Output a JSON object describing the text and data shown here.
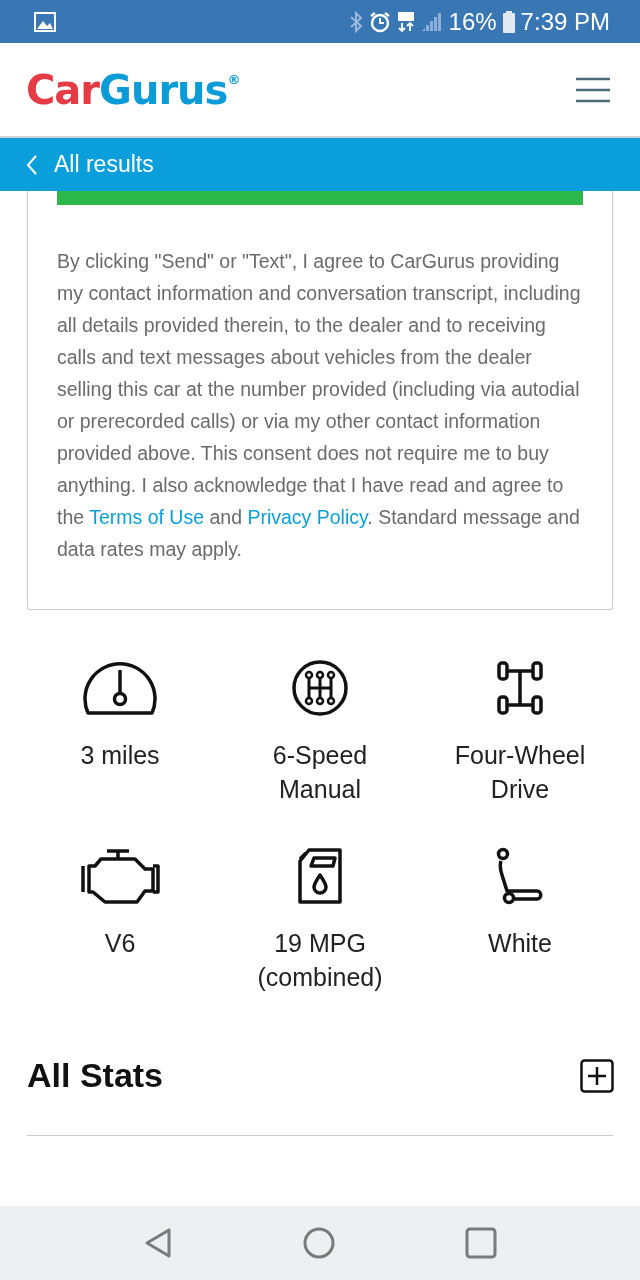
{
  "status_bar": {
    "battery": "16%",
    "time": "7:39 PM"
  },
  "header": {
    "logo": {
      "first": "Car",
      "second": "Gurus",
      "mark": "®"
    }
  },
  "nav_bar": {
    "back_label": "All results"
  },
  "consent": {
    "segments": [
      {
        "kind": "text",
        "text": "By clicking \"Send\" or \"Text\", I agree to CarGurus providing my contact information and conversation transcript, including all details provided therein, to the dealer and to receiving calls and text messages about vehicles from the dealer selling this car at the number provided (including via autodial or prerecorded calls) or via my other contact information provided above. This consent does not require me to buy anything. I also acknowledge that I have read and agree to the "
      },
      {
        "kind": "link",
        "text": "Terms of Use"
      },
      {
        "kind": "text",
        "text": " and "
      },
      {
        "kind": "link",
        "text": "Privacy Policy"
      },
      {
        "kind": "text",
        "text": ". Standard message and data rates may apply."
      }
    ]
  },
  "specs": [
    {
      "kind": "mileage",
      "label": "3 miles"
    },
    {
      "kind": "transmission",
      "label": "6-Speed Manual"
    },
    {
      "kind": "drivetrain",
      "label": "Four-Wheel Drive"
    },
    {
      "kind": "engine",
      "label": "V6"
    },
    {
      "kind": "fuel",
      "label": "19 MPG (combined)"
    },
    {
      "kind": "interior",
      "label": "White"
    }
  ],
  "all_stats": {
    "title": "All Stats",
    "expanded": false
  }
}
